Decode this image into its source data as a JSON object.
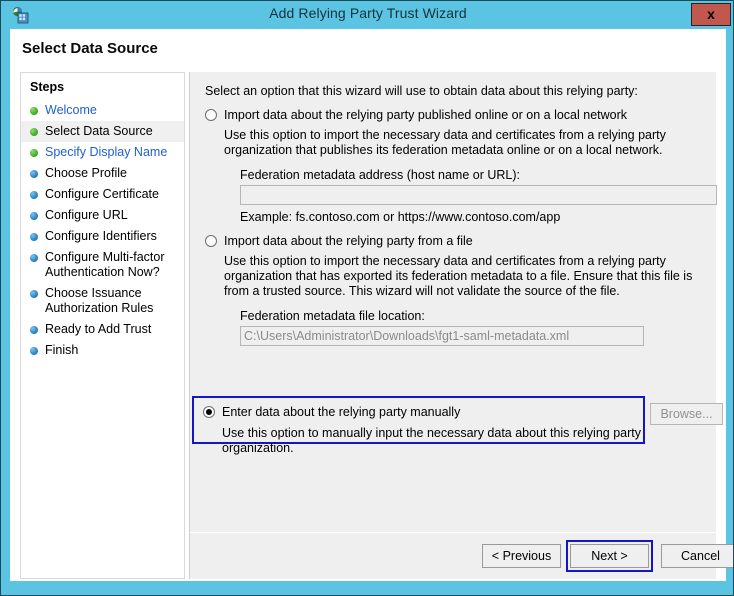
{
  "window": {
    "title": "Add Relying Party Trust Wizard",
    "icon": "wizard-app-icon",
    "close_label": "x",
    "accent_color": "#5bc4e3",
    "close_color": "#c2574e",
    "focus_ring_color": "#1414c8"
  },
  "page": {
    "header": "Select Data Source"
  },
  "sidebar": {
    "title": "Steps",
    "items": [
      {
        "label": "Welcome",
        "bullet": "green",
        "state": "link"
      },
      {
        "label": "Select Data Source",
        "bullet": "green",
        "state": "current"
      },
      {
        "label": "Specify Display Name",
        "bullet": "green",
        "state": "link"
      },
      {
        "label": "Choose Profile",
        "bullet": "blue",
        "state": "pending"
      },
      {
        "label": "Configure Certificate",
        "bullet": "blue",
        "state": "pending"
      },
      {
        "label": "Configure URL",
        "bullet": "blue",
        "state": "pending"
      },
      {
        "label": "Configure Identifiers",
        "bullet": "blue",
        "state": "pending"
      },
      {
        "label": "Configure Multi-factor Authentication Now?",
        "bullet": "blue",
        "state": "pending"
      },
      {
        "label": "Choose Issuance Authorization Rules",
        "bullet": "blue",
        "state": "pending"
      },
      {
        "label": "Ready to Add Trust",
        "bullet": "blue",
        "state": "pending"
      },
      {
        "label": "Finish",
        "bullet": "blue",
        "state": "pending"
      }
    ]
  },
  "main": {
    "intro": "Select an option that this wizard will use to obtain data about this relying party:",
    "options": [
      {
        "id": "import-online",
        "label": "Import data about the relying party published online or on a local network",
        "description": "Use this option to import the necessary data and certificates from a relying party organization that publishes its federation metadata online or on a local network.",
        "field_label": "Federation metadata address (host name or URL):",
        "field_value": "",
        "field_placeholder": "",
        "hint": "Example: fs.contoso.com or https://www.contoso.com/app",
        "selected": false
      },
      {
        "id": "import-file",
        "label": "Import data about the relying party from a file",
        "description": "Use this option to import the necessary data and certificates from a relying party organization that has exported its federation metadata to a file. Ensure that this file is from a trusted source.  This wizard will not validate the source of the file.",
        "field_label": "Federation metadata file location:",
        "field_value": "C:\\Users\\Administrator\\Downloads\\fgt1-saml-metadata.xml",
        "browse_label": "Browse...",
        "selected": false
      },
      {
        "id": "enter-manually",
        "label": "Enter data about the relying party manually",
        "description": "Use this option to manually input the necessary data about this relying party organization.",
        "selected": true,
        "focused": true
      }
    ]
  },
  "footer": {
    "previous_label": "< Previous",
    "next_label": "Next >",
    "cancel_label": "Cancel",
    "focused_button": "Next >"
  }
}
